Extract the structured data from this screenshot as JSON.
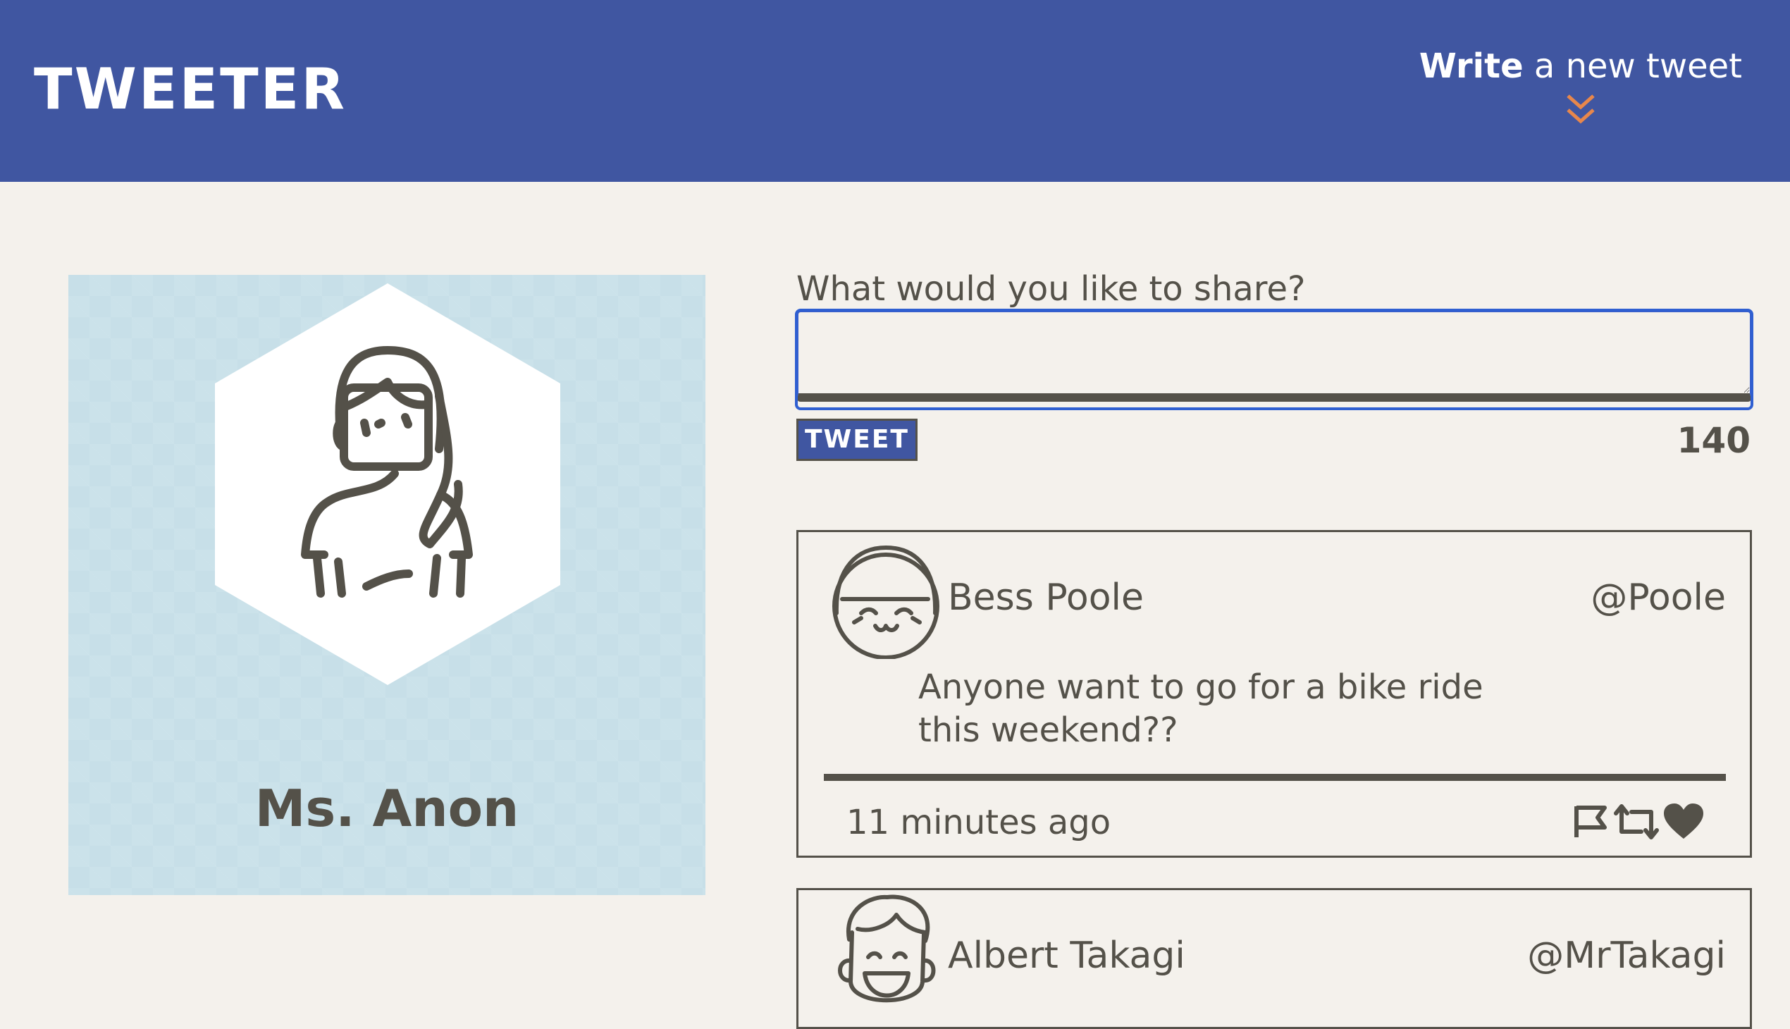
{
  "header": {
    "brand": "Tweeter",
    "compose_toggle": {
      "bold": "Write",
      "rest": " a new tweet"
    },
    "icons": {
      "compose_toggle": "double-chevron-down-icon"
    }
  },
  "profile": {
    "name": "Ms. Anon",
    "avatar": "female-avatar-icon"
  },
  "composer": {
    "label": "What would you like to share?",
    "value": "",
    "placeholder": "",
    "button_label": "Tweet",
    "counter": "140"
  },
  "tweets": [
    {
      "name": "Bess Poole",
      "handle": "@Poole",
      "avatar": "smiling-woman-avatar-icon",
      "body": "Anyone want to go for a bike ride this weekend??",
      "time": "11 minutes ago",
      "actions": [
        "flag-icon",
        "retweet-icon",
        "heart-icon"
      ]
    },
    {
      "name": "Albert Takagi",
      "handle": "@MrTakagi",
      "avatar": "laughing-man-avatar-icon"
    }
  ],
  "colors": {
    "header_bg": "#4056a1",
    "page_bg": "#f4f1ec",
    "accent": "#e8874b",
    "text": "#545149",
    "profile_bg": "#c7dfe8"
  }
}
